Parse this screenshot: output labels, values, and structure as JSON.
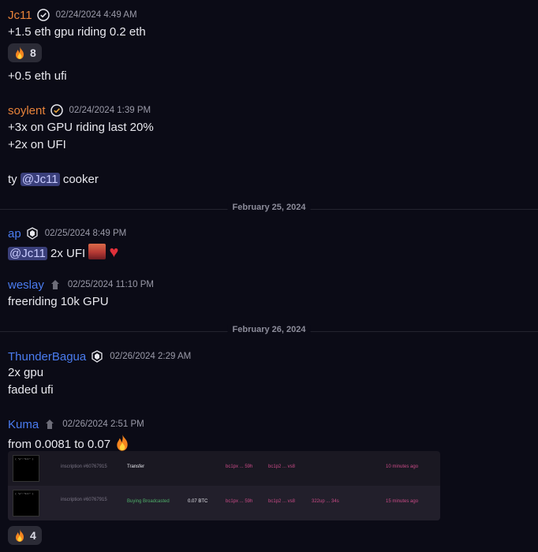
{
  "messages": {
    "m1": {
      "author": "Jc11",
      "author_color": "#e8833a",
      "timestamp": "02/24/2024 4:49 AM",
      "line1": "+1.5 eth gpu riding 0.2 eth",
      "reaction_count": "8",
      "line2": "+0.5 eth ufi"
    },
    "m2": {
      "author": "soylent",
      "author_color": "#e8833a",
      "timestamp": "02/24/2024 1:39 PM",
      "line1": "+3x on GPU riding last 20%",
      "line2": "+2x on UFI",
      "line3_prefix": "ty",
      "mention": "@Jc11",
      "line3_suffix": "cooker"
    },
    "divider1": "February 25, 2024",
    "m3": {
      "author": "ap",
      "author_color": "#4a7cf0",
      "timestamp": "02/25/2024 8:49 PM",
      "mention": "@Jc11",
      "text": "2x UFI"
    },
    "m4": {
      "author": "weslay",
      "author_color": "#4a7cf0",
      "timestamp": "02/25/2024 11:10 PM",
      "line1": "freeriding 10k GPU"
    },
    "divider2": "February 26, 2024",
    "m5": {
      "author": "ThunderBagua",
      "author_color": "#4a7cf0",
      "timestamp": "02/26/2024 2:29 AM",
      "line1": "2x gpu",
      "line2": "faded ufi"
    },
    "m6": {
      "author": "Kuma",
      "author_color": "#4a7cf0",
      "timestamp": "02/26/2024 2:51 PM",
      "line1": "from 0.0081 to 0.07",
      "reaction_count": "4"
    }
  },
  "embed": {
    "rows": [
      {
        "inscription": "inscription #60767915",
        "type": "Transfer",
        "price": "",
        "from": "bc1px ... 59h",
        "to": "bc1p2 ... vs8",
        "extra": "",
        "time": "10 minutes ago"
      },
      {
        "inscription": "inscription #60767915",
        "type": "Buying Broadcasted",
        "price": "0.07 BTC",
        "from": "bc1px ... 59h",
        "to": "bc1p2 ... vs8",
        "extra": "322up ... 34s",
        "time": "15 minutes ago"
      }
    ]
  },
  "colors": {
    "background": "#0b0b16",
    "mention_bg": "#3a3f7a",
    "accent_pink": "#c94a86",
    "accent_green": "#4fb06a"
  }
}
